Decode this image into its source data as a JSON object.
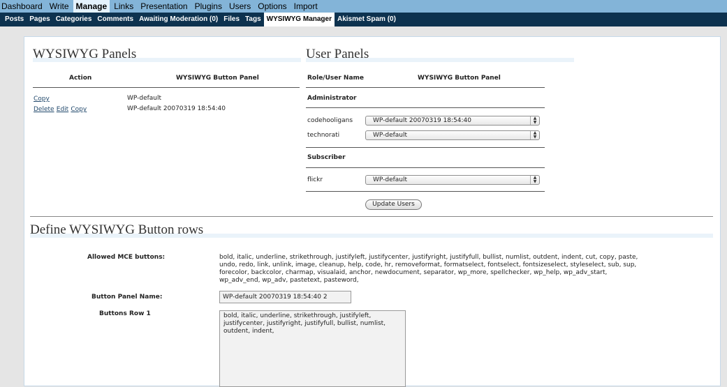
{
  "menu": {
    "items": [
      "Dashboard",
      "Write",
      "Manage",
      "Links",
      "Presentation",
      "Plugins",
      "Users",
      "Options",
      "Import"
    ],
    "current": "Manage"
  },
  "submenu": {
    "items": [
      "Posts",
      "Pages",
      "Categories",
      "Comments",
      "Awaiting Moderation (0)",
      "Files",
      "Tags",
      "WYSIWYG Manager",
      "Akismet Spam (0)"
    ],
    "current": "WYSIWYG Manager"
  },
  "wysiwyg_panels": {
    "title": "WYSIWYG Panels",
    "col_action": "Action",
    "col_panel": "WYSIWYG Button Panel",
    "rows": [
      {
        "actions": [
          "Copy"
        ],
        "panel": "WP-default"
      },
      {
        "actions": [
          "Delete",
          "Edit",
          "Copy"
        ],
        "panel": "WP-default 20070319 18:54:40"
      }
    ]
  },
  "user_panels": {
    "title": "User Panels",
    "col_role": "Role/User Name",
    "col_panel": "WYSIWYG Button Panel",
    "groups": [
      {
        "role": "Administrator",
        "users": [
          {
            "name": "codehooligans",
            "panel": "WP-default 20070319 18:54:40"
          },
          {
            "name": "technorati",
            "panel": "WP-default"
          }
        ]
      },
      {
        "role": "Subscriber",
        "users": [
          {
            "name": "flickr",
            "panel": "WP-default"
          }
        ]
      }
    ],
    "update_button": "Update Users"
  },
  "define_rows": {
    "title": "Define WYSIWYG Button rows",
    "allowed_label": "Allowed MCE buttons:",
    "allowed_lines": [
      "bold, italic, underline, strikethrough, justifyleft, justifycenter, justifyright, justifyfull, bullist, numlist, outdent, indent, cut, copy, paste,",
      "undo, redo, link, unlink, image, cleanup, help, code, hr, removeformat, formatselect, fontselect, fontsizeselect, styleselect, sub, sup,",
      "forecolor, backcolor, charmap, visualaid, anchor, newdocument, separator, wp_more, spellchecker, wp_help, wp_adv_start,",
      "wp_adv_end, wp_adv, pastetext, pasteword,"
    ],
    "panel_name_label": "Button Panel Name:",
    "panel_name_value": "WP-default 20070319 18:54:40 2",
    "row1_label": "Buttons Row 1",
    "row1_value": "bold, italic, underline, strikethrough, justifyleft,\njustifycenter, justifyright, justifyfull, bullist, numlist,\noutdent, indent,"
  }
}
